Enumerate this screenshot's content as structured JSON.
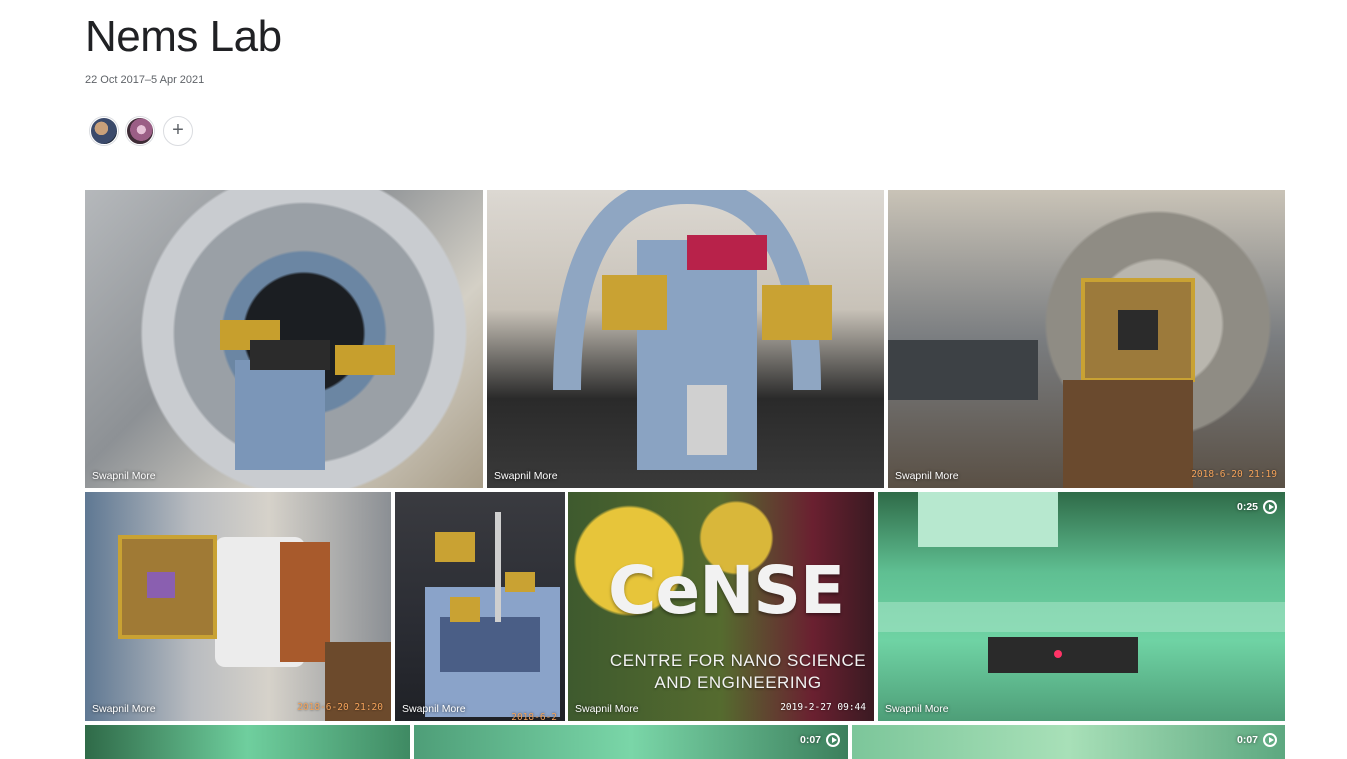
{
  "album": {
    "title": "Nems Lab",
    "date_range": "22 Oct 2017–5 Apr 2021"
  },
  "sharing": {
    "members": [
      "member-1",
      "member-2"
    ],
    "add_label": "+"
  },
  "photos": [
    {
      "owner": "Swapnil More",
      "stamp": "",
      "duration": ""
    },
    {
      "owner": "Swapnil More",
      "stamp": "",
      "duration": ""
    },
    {
      "owner": "Swapnil More",
      "stamp": "2018-6-20 21:19",
      "duration": ""
    },
    {
      "owner": "Swapnil More",
      "stamp": "2018-6-20 21:20",
      "duration": ""
    },
    {
      "owner": "Swapnil More",
      "stamp": "2018-6-2",
      "duration": ""
    },
    {
      "owner": "Swapnil More",
      "stamp": "2019-2-27 09:44",
      "duration": "",
      "sign_word": "CeNSE",
      "sign_sub": "CENTRE FOR NANO SCIENCE AND ENGINEERING"
    },
    {
      "owner": "Swapnil More",
      "stamp": "",
      "duration": "0:25"
    },
    {
      "owner": "",
      "stamp": "",
      "duration": ""
    },
    {
      "owner": "",
      "stamp": "",
      "duration": "0:07"
    },
    {
      "owner": "",
      "stamp": "",
      "duration": "0:07"
    }
  ],
  "icons": {
    "play": "play-circle-icon",
    "add": "add-person-icon"
  }
}
